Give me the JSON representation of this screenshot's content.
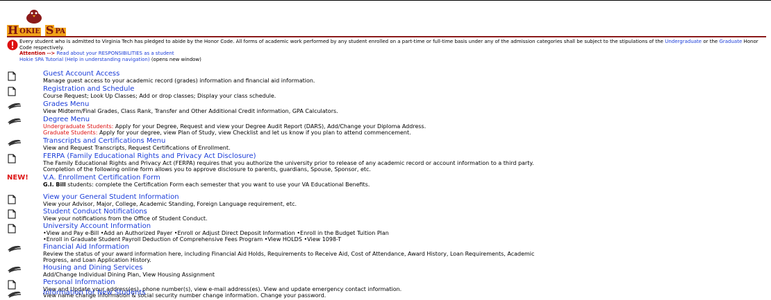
{
  "logo": {
    "first_letter": "H",
    "rest1": "OKIE",
    "second_letter": "S",
    "rest2": "PA"
  },
  "honor": {
    "text": "Every student who is admitted to Virginia Tech has pledged to abide by the Honor Code. All forms of academic work performed by any student enrolled on a part-time or full-time basis under any of the admission categories shall be subject to the stipulations of the",
    "undergrad_link": "Undergraduate",
    "or": "or the",
    "grad_link": "Graduate",
    "end": "Honor Code respectively.",
    "attention": "Attention",
    "arrow": "-->",
    "resp_link": "Read about your RESPONSIBILITIES as a student",
    "tutorial_link": "Hokie SPA Tutorial (Help in understanding navigation)",
    "tutorial_note": "(opens new window)"
  },
  "menu": [
    {
      "icon": "page-icon",
      "title": "Guest Account Access",
      "desc": [
        "Manage guest access to your academic record (grades) information and financial aid information."
      ]
    },
    {
      "icon": "page-icon",
      "title": "Registration and Schedule",
      "desc": [
        "Course Request; Look Up Classes; Add or drop classes; Display your class schedule."
      ]
    },
    {
      "icon": "menu-icon",
      "title": "Grades Menu",
      "desc": [
        "View Midterm/Final Grades, Class Rank, Transfer and Other Additional Credit information, GPA Calculators."
      ]
    },
    {
      "icon": "menu-icon",
      "title": "Degree Menu",
      "desc_u_label": "Undergraduate Students:",
      "desc_u": "Apply for your Degree, Request and view your Degree Audit Report (DARS), Add/Change your Diploma Address.",
      "desc_g_label": "Graduate Students:",
      "desc_g": "Apply for your degree, view Plan of Study, view Checklist and let us know if you plan to attend commencement."
    },
    {
      "icon": "menu-icon",
      "title": "Transcripts and Certifications Menu",
      "desc": [
        "View and Request Transcripts, Request Certifications of Enrollment."
      ]
    },
    {
      "icon": "page-icon",
      "title": "FERPA (Family Educational Rights and Privacy Act Disclosure)",
      "desc": [
        "The Family Educational Rights and Privacy Act (FERPA) requires that you authorize the university prior to release of any academic record or account information to a third party.",
        "Completion of the following online form allows you to approve disclosure to parents, guardians, Spouse, Sponsor, etc."
      ]
    },
    {
      "icon": "new-badge",
      "badge": "NEW!",
      "title": "V.A. Enrollment Certification Form",
      "desc_bold": "G.I. Bill",
      "desc_rest": "students: complete the Certification Form each semester that you want to use your VA Educational Benefits."
    },
    {
      "icon": "page-icon",
      "title": "View your General Student Information",
      "desc": [
        "View your Advisor, Major, College, Academic Standing, Foreign Language requirement, etc."
      ]
    },
    {
      "icon": "page-icon",
      "title": "Student Conduct Notifications",
      "desc": [
        "View your notifications from the Office of Student Conduct."
      ]
    },
    {
      "icon": "page-icon",
      "title": "University Account Information",
      "desc": [
        "•View and Pay e-Bill •Add an Authorized Payer •Enroll or Adjust Direct Deposit Information •Enroll in the Budget Tuition Plan",
        "•Enroll in Graduate Student Payroll Deduction of Comprehensive Fees Program •View HOLDS •View 1098-T"
      ]
    },
    {
      "icon": "menu-icon",
      "title": "Financial Aid Information",
      "desc": [
        "Review the status of your award information here, including Financial Aid Holds, Requirements to Receive Aid, Cost of Attendance, Award History, Loan Requirements, Academic",
        "Progress, and Loan Application History."
      ]
    },
    {
      "icon": "menu-icon",
      "title": "Housing and Dining Services",
      "desc": [
        "Add/Change Individual Dining Plan, View Housing Assignment"
      ]
    },
    {
      "icon": "page-icon",
      "title": "Personal Information",
      "desc": [
        "View and Update your address(es), phone number(s), view e-mail address(es). View and update emergency contact information.",
        "View name change information & social security number change information. Change your password."
      ]
    },
    {
      "icon": "menu-icon",
      "title": "Information for New Students",
      "desc": []
    }
  ]
}
